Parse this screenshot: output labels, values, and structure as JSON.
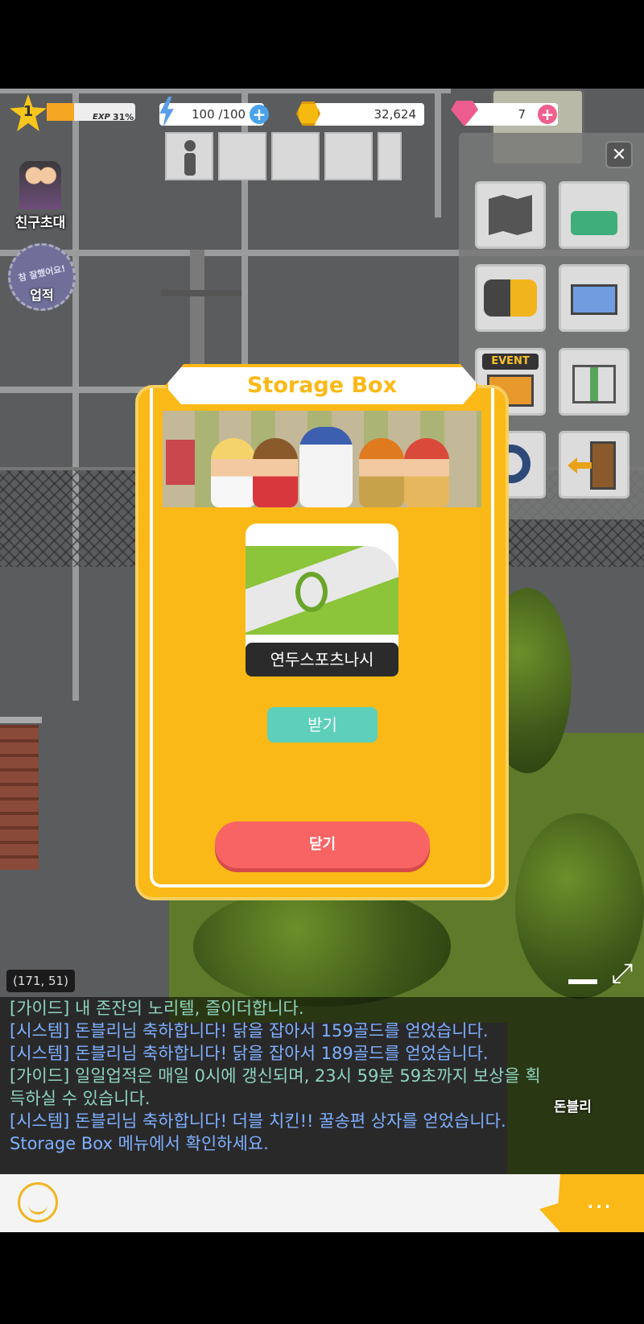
{
  "hud": {
    "level": "1",
    "exp_label": "EXP",
    "exp_value": "31%",
    "exp_fraction": 0.31,
    "energy": "100 /100",
    "gold": "32,624",
    "gems": "7"
  },
  "left_menu": {
    "invite_label": "친구초대",
    "achievement_badge": "참 잘했어요!",
    "achievement_label": "업적"
  },
  "side_menu": {
    "event_label": "EVENT"
  },
  "modal": {
    "title": "Storage Box",
    "item_name": "연두스포츠나시",
    "receive_label": "받기",
    "close_label": "닫기"
  },
  "coords": "(171, 51)",
  "chat": {
    "lines": [
      {
        "text": "[가이드] 내 존잔의 노리텔, 즐이더합니다.",
        "color": "#8fd4c0"
      },
      {
        "text": "[시스템] 돈블리님 축하합니다! 닭을 잡아서 159골드를 얻었습니다.",
        "color": "#7fb0ff"
      },
      {
        "text": "[시스템] 돈블리님 축하합니다! 닭을 잡아서 189골드를 얻었습니다.",
        "color": "#7fb0ff"
      },
      {
        "text": "[가이드] 일일업적은 매일 0시에 갱신되며, 23시 59분 59초까지 보상을 획",
        "color": "#8fd4c0"
      },
      {
        "text": "득하실 수 있습니다.",
        "color": "#8fd4c0"
      },
      {
        "text": "[시스템] 돈블리님 축하합니다! 더블 치킨!! 꿀송편 상자를 얻었습니다.",
        "color": "#7fb0ff"
      },
      {
        "text": "Storage Box 메뉴에서 확인하세요.",
        "color": "#7fb0ff"
      }
    ],
    "player_name": "돈블리"
  },
  "colors": {
    "modal_bg": "#fbb917",
    "receive": "#5ecfbb",
    "close": "#f86464"
  }
}
